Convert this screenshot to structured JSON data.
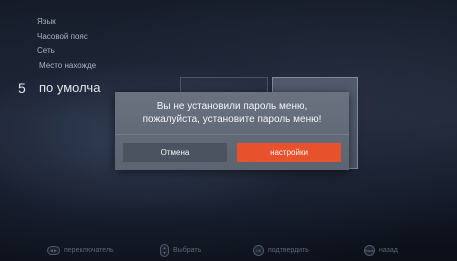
{
  "background_menu": {
    "items": [
      "Язык",
      "Часовой пояс",
      "Сеть",
      "Место нахожде"
    ],
    "number": "5",
    "default_label": "по умолча"
  },
  "dialog": {
    "message_line1": "Вы не установили пароль меню,",
    "message_line2": "пожалуйста, установите пароль меню!",
    "cancel_label": "Отмена",
    "settings_label": "настройки",
    "accent_color": "#e7522d"
  },
  "footer": {
    "switch_label": "переключатель",
    "select_label": "Выбрать",
    "ok_icon_text": "OK",
    "confirm_label": "подтвердить",
    "back_icon_text": "Back",
    "back_label": "назад"
  }
}
